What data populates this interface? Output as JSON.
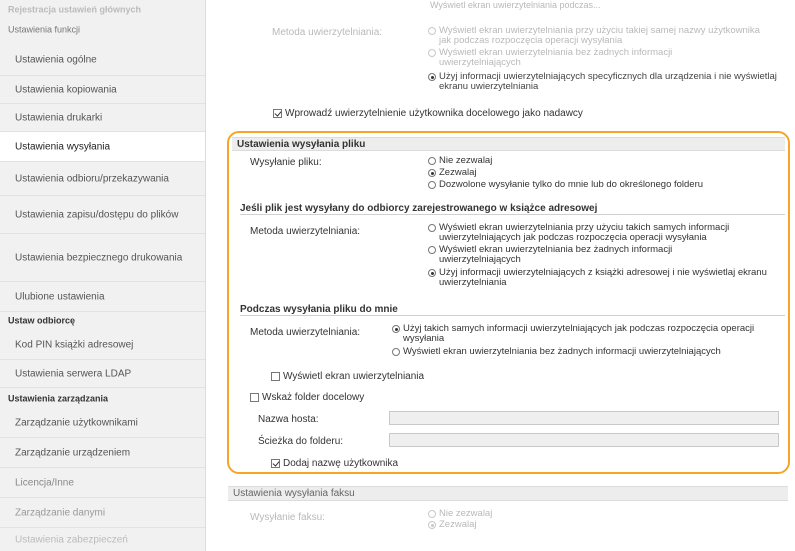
{
  "sidebar": {
    "top_faded": "Rejestracja ustawień głównych",
    "section_funkcji": "Ustawienia funkcji",
    "items_funkcji": [
      "Ustawienia ogólne",
      "Ustawienia kopiowania",
      "Ustawienia drukarki",
      "Ustawienia wysyłania",
      "Ustawienia odbioru/przekazywania",
      "Ustawienia zapisu/dostępu do plików",
      "Ustawienia bezpiecznego drukowania",
      "Ulubione ustawienia"
    ],
    "section_odbiorcy": "Ustaw odbiorcę",
    "items_odbiorcy": [
      "Kod PIN książki adresowej",
      "Ustawienia serwera LDAP"
    ],
    "section_zarzadzania": "Ustawienia zarządzania",
    "items_zarzadzania": [
      "Zarządzanie użytkownikami",
      "Zarządzanie urządzeniem",
      "Licencja/Inne",
      "Zarządzanie danymi",
      "Ustawienia zabezpieczeń"
    ]
  },
  "top": {
    "faded_top_text": "Wyświetl ekran uwierzytelniania podczas...",
    "auth_label": "Metoda uwierzytelniania:",
    "options": [
      "Wyświetl ekran uwierzytelniania przy użyciu takiej samej nazwy użytkownika jak podczas rozpoczęcia operacji wysyłania",
      "Wyświetl ekran uwierzytelniania bez żadnych informacji uwierzytelniających",
      "Użyj informacji uwierzytelniających specyficznych dla urządzenia i nie wyświetlaj ekranu uwierzytelniania"
    ],
    "checkbox_label": "Wprowadź uwierzytelnienie użytkownika docelowego jako nadawcy"
  },
  "file_send": {
    "section_title": "Ustawienia wysyłania pliku",
    "send_label": "Wysyłanie pliku:",
    "send_options": [
      "Nie zezwalaj",
      "Zezwalaj",
      "Dozwolone wysyłanie tylko do mnie lub do określonego folderu"
    ],
    "registered_head": "Jeśli plik jest wysyłany do odbiorcy zarejestrowanego w książce adresowej",
    "registered_label": "Metoda uwierzytelniania:",
    "registered_options": [
      "Wyświetl ekran uwierzytelniania przy użyciu takich samych informacji uwierzytelniających jak podczas rozpoczęcia operacji wysyłania",
      "Wyświetl ekran uwierzytelniania bez żadnych informacji uwierzytelniających",
      "Użyj informacji uwierzytelniających z książki adresowej i nie wyświetlaj ekranu uwierzytelniania"
    ],
    "tome_head": "Podczas wysyłania pliku do mnie",
    "tome_label": "Metoda uwierzytelniania:",
    "tome_options": [
      "Użyj takich samych informacji uwierzytelniających jak podczas rozpoczęcia operacji wysyłania",
      "Wyświetl ekran uwierzytelniania bez żadnych informacji uwierzytelniających"
    ],
    "show_auth_checkbox": "Wyświetl ekran uwierzytelniania",
    "dest_folder_checkbox": "Wskaż folder docelowy",
    "host_label": "Nazwa hosta:",
    "host_value": "",
    "path_label": "Ścieżka do folderu:",
    "path_value": "",
    "add_username_checkbox": "Dodaj nazwę użytkownika"
  },
  "fax_send": {
    "section_title": "Ustawienia wysyłania faksu",
    "send_label": "Wysyłanie faksu:",
    "options": [
      "Nie zezwalaj",
      "Zezwalaj"
    ]
  },
  "colors": {
    "highlight": "#f5a623"
  }
}
